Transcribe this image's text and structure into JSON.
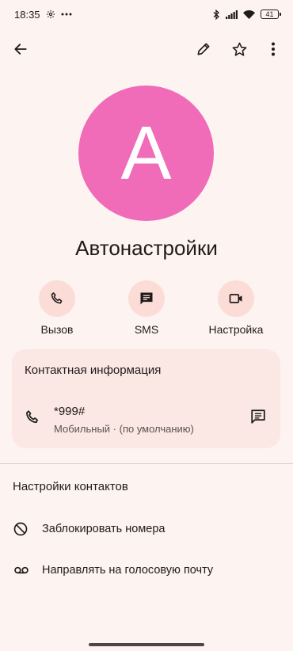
{
  "status_bar": {
    "time": "18:35",
    "battery": "41"
  },
  "contact": {
    "initial": "A",
    "name": "Автонастройки"
  },
  "actions": [
    {
      "label": "Вызов",
      "icon": "phone-icon"
    },
    {
      "label": "SMS",
      "icon": "message-icon"
    },
    {
      "label": "Настройка",
      "icon": "video-icon"
    }
  ],
  "contact_info": {
    "title": "Контактная информация",
    "number": "*999#",
    "subtitle": "Мобильный · (по умолчанию)"
  },
  "contact_settings": {
    "title": "Настройки контактов",
    "items": [
      {
        "label": "Заблокировать номера",
        "icon": "block-icon"
      },
      {
        "label": "Направлять на голосовую почту",
        "icon": "voicemail-icon"
      }
    ]
  },
  "colors": {
    "background": "#fdf3f1",
    "avatar": "#f06bb8",
    "action_circle": "#fcdcd6",
    "card": "#fbe7e3"
  }
}
